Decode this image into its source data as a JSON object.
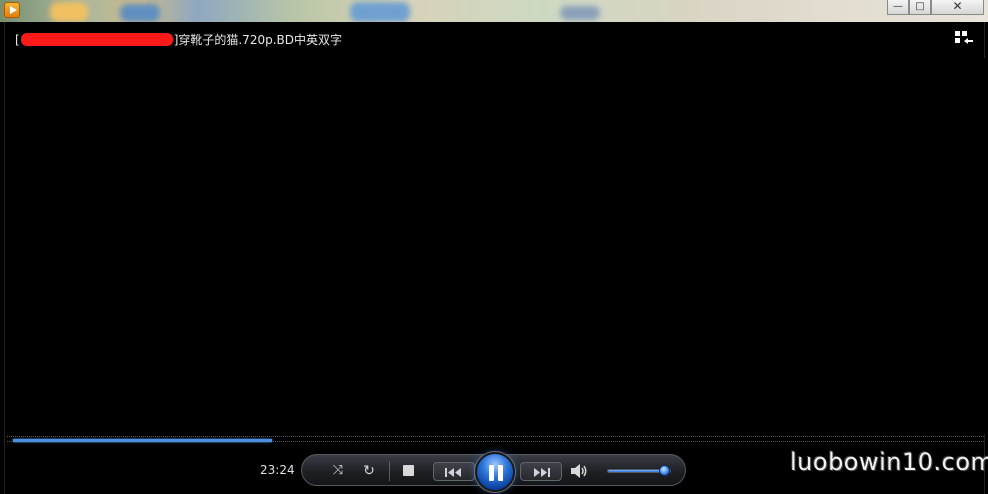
{
  "window": {
    "minimize_glyph": "—",
    "maximize_glyph": "□",
    "close_glyph": "✕"
  },
  "player": {
    "title_prefix": "[",
    "title_suffix": "]穿靴子的猫.720p.BD中英双字",
    "current_time": "23:24",
    "seek_progress": 0.27,
    "volume_level": 0.9,
    "state": "playing"
  },
  "icons": {
    "app": "media-player-icon",
    "switch_view": "switch-to-library-icon",
    "shuffle": "shuffle-icon",
    "repeat": "repeat-icon",
    "stop": "stop-icon",
    "previous": "previous-icon",
    "play_pause": "pause-icon",
    "next": "next-icon",
    "volume": "volume-icon"
  },
  "colors": {
    "accent": "#2c74d8",
    "seek_fill": "#4a8fe0",
    "redaction": "#ff1a1a"
  },
  "watermark": "luobowin10.com"
}
